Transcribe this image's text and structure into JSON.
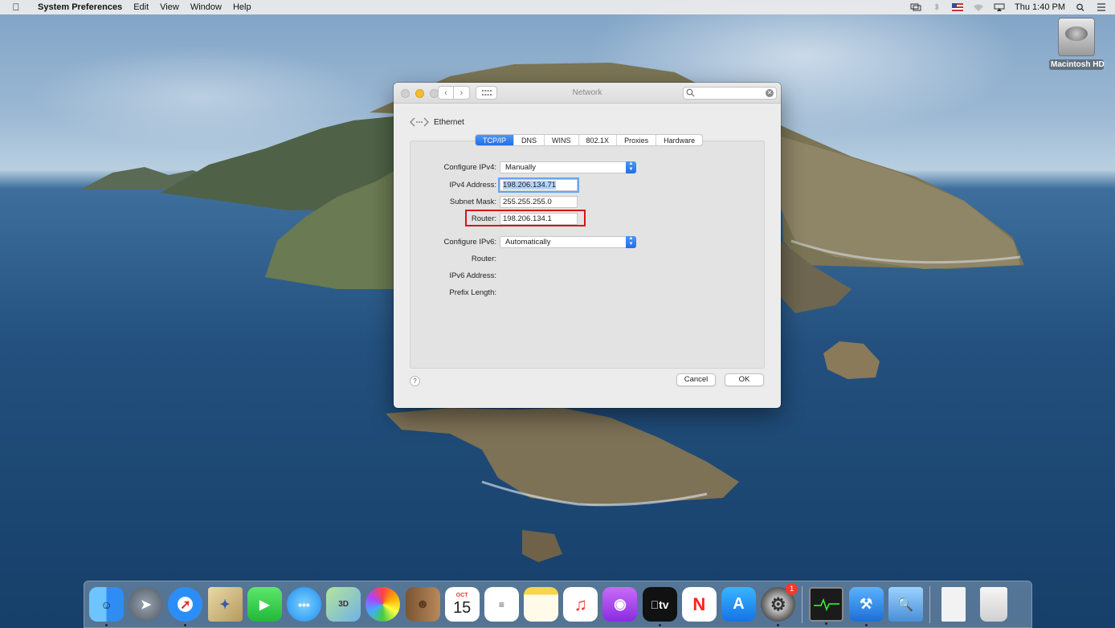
{
  "menubar": {
    "app_name": "System Preferences",
    "menus": [
      "Edit",
      "View",
      "Window",
      "Help"
    ],
    "clock": "Thu 1:40 PM"
  },
  "desktop": {
    "drive_label": "Macintosh HD"
  },
  "window": {
    "title": "Network",
    "search_placeholder": "",
    "interface_name": "Ethernet",
    "tabs": [
      "TCP/IP",
      "DNS",
      "WINS",
      "802.1X",
      "Proxies",
      "Hardware"
    ],
    "active_tab": "TCP/IP",
    "ipv4": {
      "configure_label": "Configure IPv4:",
      "configure_value": "Manually",
      "address_label": "IPv4 Address:",
      "address_value": "198.206.134.71",
      "subnet_label": "Subnet Mask:",
      "subnet_value": "255.255.255.0",
      "router_label": "Router:",
      "router_value": "198.206.134.1"
    },
    "ipv6": {
      "configure_label": "Configure IPv6:",
      "configure_value": "Automatically",
      "router_label": "Router:",
      "address_label": "IPv6 Address:",
      "prefix_label": "Prefix Length:"
    },
    "help_label": "?",
    "cancel_label": "Cancel",
    "ok_label": "OK",
    "highlight_color": "#d8141b"
  },
  "dock": {
    "calendar_month": "OCT",
    "calendar_day": "15",
    "tv_label": "tv",
    "system_prefs_badge": "1",
    "items": [
      "finder-icon",
      "launchpad-icon",
      "safari-icon",
      "mail-icon",
      "facetime-icon",
      "messages-icon",
      "maps-icon",
      "photos-icon",
      "contacts-icon",
      "calendar-icon",
      "reminders-icon",
      "notes-icon",
      "music-icon",
      "podcasts-icon",
      "tv-icon",
      "news-icon",
      "app-store-icon",
      "system-preferences-icon",
      "activity-monitor-icon",
      "xcode-icon",
      "preview-icon",
      "document-icon",
      "trash-icon"
    ]
  }
}
